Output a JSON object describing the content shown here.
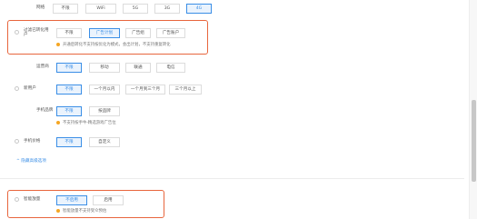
{
  "network": {
    "label": "网络",
    "options": [
      "不限",
      "WiFi",
      "5G",
      "3G",
      "4G"
    ],
    "selected": "4G"
  },
  "installed_filter": {
    "label": "过滤已转化用户",
    "options": [
      "不限",
      "广告计划",
      "广告组",
      "广告账户"
    ],
    "selected": "广告计划",
    "hint": "开通后转化不支持按优化为模式，会出计划，不支持重复转化"
  },
  "operator": {
    "label": "运营商",
    "options": [
      "不限",
      "移动",
      "联通",
      "电信"
    ],
    "selected": "不限"
  },
  "new_device": {
    "label": "新用户",
    "options": [
      "不限",
      "一个月以内",
      "一个月到三个月",
      "三个月以上"
    ],
    "selected": "不限"
  },
  "phone_brand": {
    "label": "手机品牌",
    "options": [
      "不限",
      "按品牌"
    ],
    "selected": "不限",
    "hint": "不支持按手牛-精选游戏广告位"
  },
  "phone_price": {
    "label": "手机价格",
    "options": [
      "不限",
      "自定义"
    ],
    "selected": "不限"
  },
  "collapse_link": "^ 隐藏高级选项",
  "smart_release": {
    "label": "智能放量",
    "options": [
      "不启用",
      "启用"
    ],
    "selected": "不启用",
    "hint": "智能放量不支持受众预估"
  },
  "colors": {
    "accent": "#3a8ee6",
    "highlight_border": "#e8663d",
    "hint_dot": "#f5a623"
  }
}
